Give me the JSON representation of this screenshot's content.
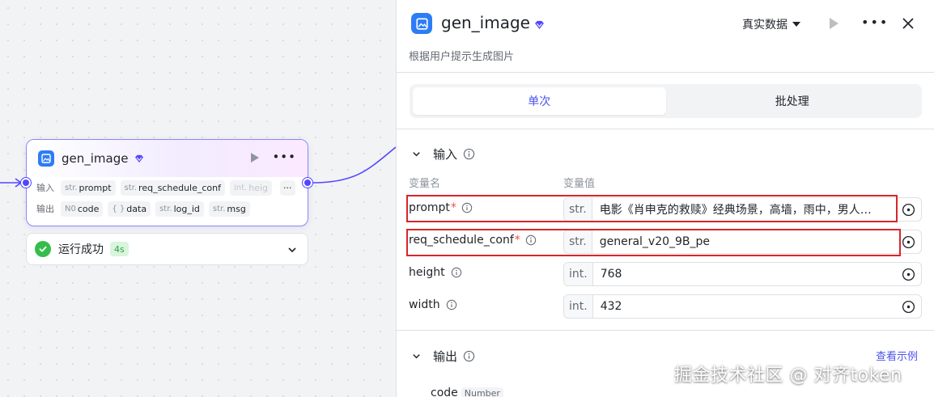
{
  "node": {
    "title": "gen_image",
    "input_label": "输入",
    "output_label": "输出",
    "inputs": [
      {
        "type": "str.",
        "name": "prompt"
      },
      {
        "type": "str.",
        "name": "req_schedule_conf"
      },
      {
        "type": "int.",
        "name": "heig"
      }
    ],
    "more_label": "···",
    "outputs": [
      {
        "type": "N0",
        "name": "code"
      },
      {
        "type": "{ }",
        "name": "data"
      },
      {
        "type": "str.",
        "name": "log_id"
      },
      {
        "type": "str.",
        "name": "msg"
      }
    ],
    "status_text": "运行成功",
    "status_time": "4s"
  },
  "panel": {
    "title": "gen_image",
    "description": "根据用户提示生成图片",
    "data_source": "真实数据",
    "tabs": [
      {
        "label": "单次",
        "active": true
      },
      {
        "label": "批处理",
        "active": false
      }
    ],
    "input_section": "输入",
    "col_name": "变量名",
    "col_value": "变量值",
    "params": [
      {
        "name": "prompt",
        "required": "*",
        "type": "str.",
        "value": "电影《肖申克的救赎》经典场景，高墙，雨中，男人…",
        "highlighted": true
      },
      {
        "name": "req_schedule_conf",
        "required": "*",
        "type": "str.",
        "value": "general_v20_9B_pe",
        "highlighted": true
      },
      {
        "name": "height",
        "required": "",
        "type": "int.",
        "value": "768",
        "highlighted": false
      },
      {
        "name": "width",
        "required": "",
        "type": "int.",
        "value": "432",
        "highlighted": false
      }
    ],
    "output_section": "输出",
    "example_link": "查看示例",
    "output_field": {
      "name": "code",
      "type": "Number"
    }
  },
  "watermark": "掘金技术社区 @ 对齐token",
  "colors": {
    "accent": "#4d53e8",
    "port": "#5147ff",
    "success": "#35bd4b",
    "highlight": "#d9252a",
    "app_icon": "#2d7cf6"
  },
  "icons": [
    "app-icon",
    "gem-icon",
    "play-icon",
    "more-icon",
    "check-icon",
    "chevron-down-icon",
    "close-icon",
    "info-icon",
    "variable-picker-icon"
  ]
}
